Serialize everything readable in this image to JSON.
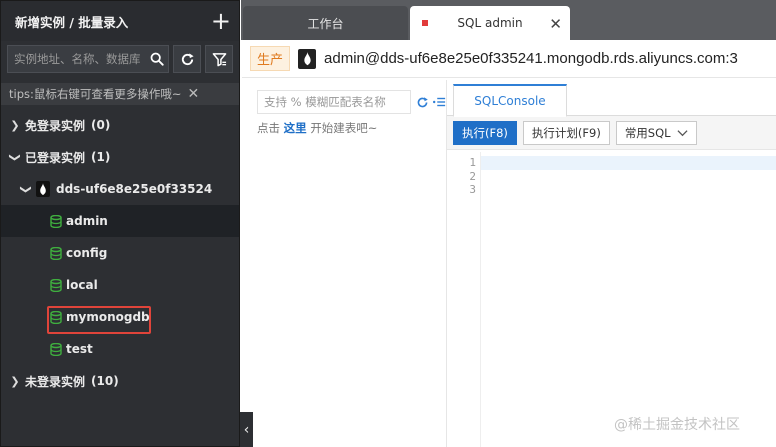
{
  "sidebar": {
    "title": "新增实例 / 批量录入",
    "add_symbol": "+",
    "search_placeholder": "实例地址、名称、数据库",
    "tips": "tips:鼠标右键可查看更多操作哦~",
    "tips_close": "✕",
    "groups": {
      "free": {
        "label": "免登录实例",
        "count": "(0)"
      },
      "logged": {
        "label": "已登录实例",
        "count": "(1)"
      },
      "unlogged": {
        "label": "未登录实例",
        "count": "(10)"
      }
    },
    "instance": {
      "name": "dds-uf6e8e25e0f33524"
    },
    "databases": [
      "admin",
      "config",
      "local",
      "mymonogdb",
      "test"
    ],
    "collapse_symbol": "‹"
  },
  "tabs": {
    "workbench": "工作台",
    "sql": "SQL admin",
    "close_symbol": "✕"
  },
  "connection": {
    "env": "生产",
    "text": "admin@dds-uf6e8e25e0f335241.mongodb.rds.aliyuncs.com:3"
  },
  "middle": {
    "search_placeholder": "支持 % 模糊匹配表名称",
    "hint_prefix": "点击",
    "hint_link": "这里",
    "hint_suffix": "开始建表吧~"
  },
  "editor": {
    "tab": "SQLConsole",
    "execute": "执行(F8)",
    "plan": "执行计划(F9)",
    "common_sql": "常用SQL",
    "line_numbers": [
      "1",
      "2",
      "3"
    ]
  },
  "watermark": "@稀土掘金技术社区",
  "colors": {
    "sidebar_bg": "#2d2f33",
    "accent_blue": "#1f6fc7",
    "db_green": "#3fae3f",
    "highlight_red": "#e0443a",
    "env_orange": "#e07a1f"
  }
}
